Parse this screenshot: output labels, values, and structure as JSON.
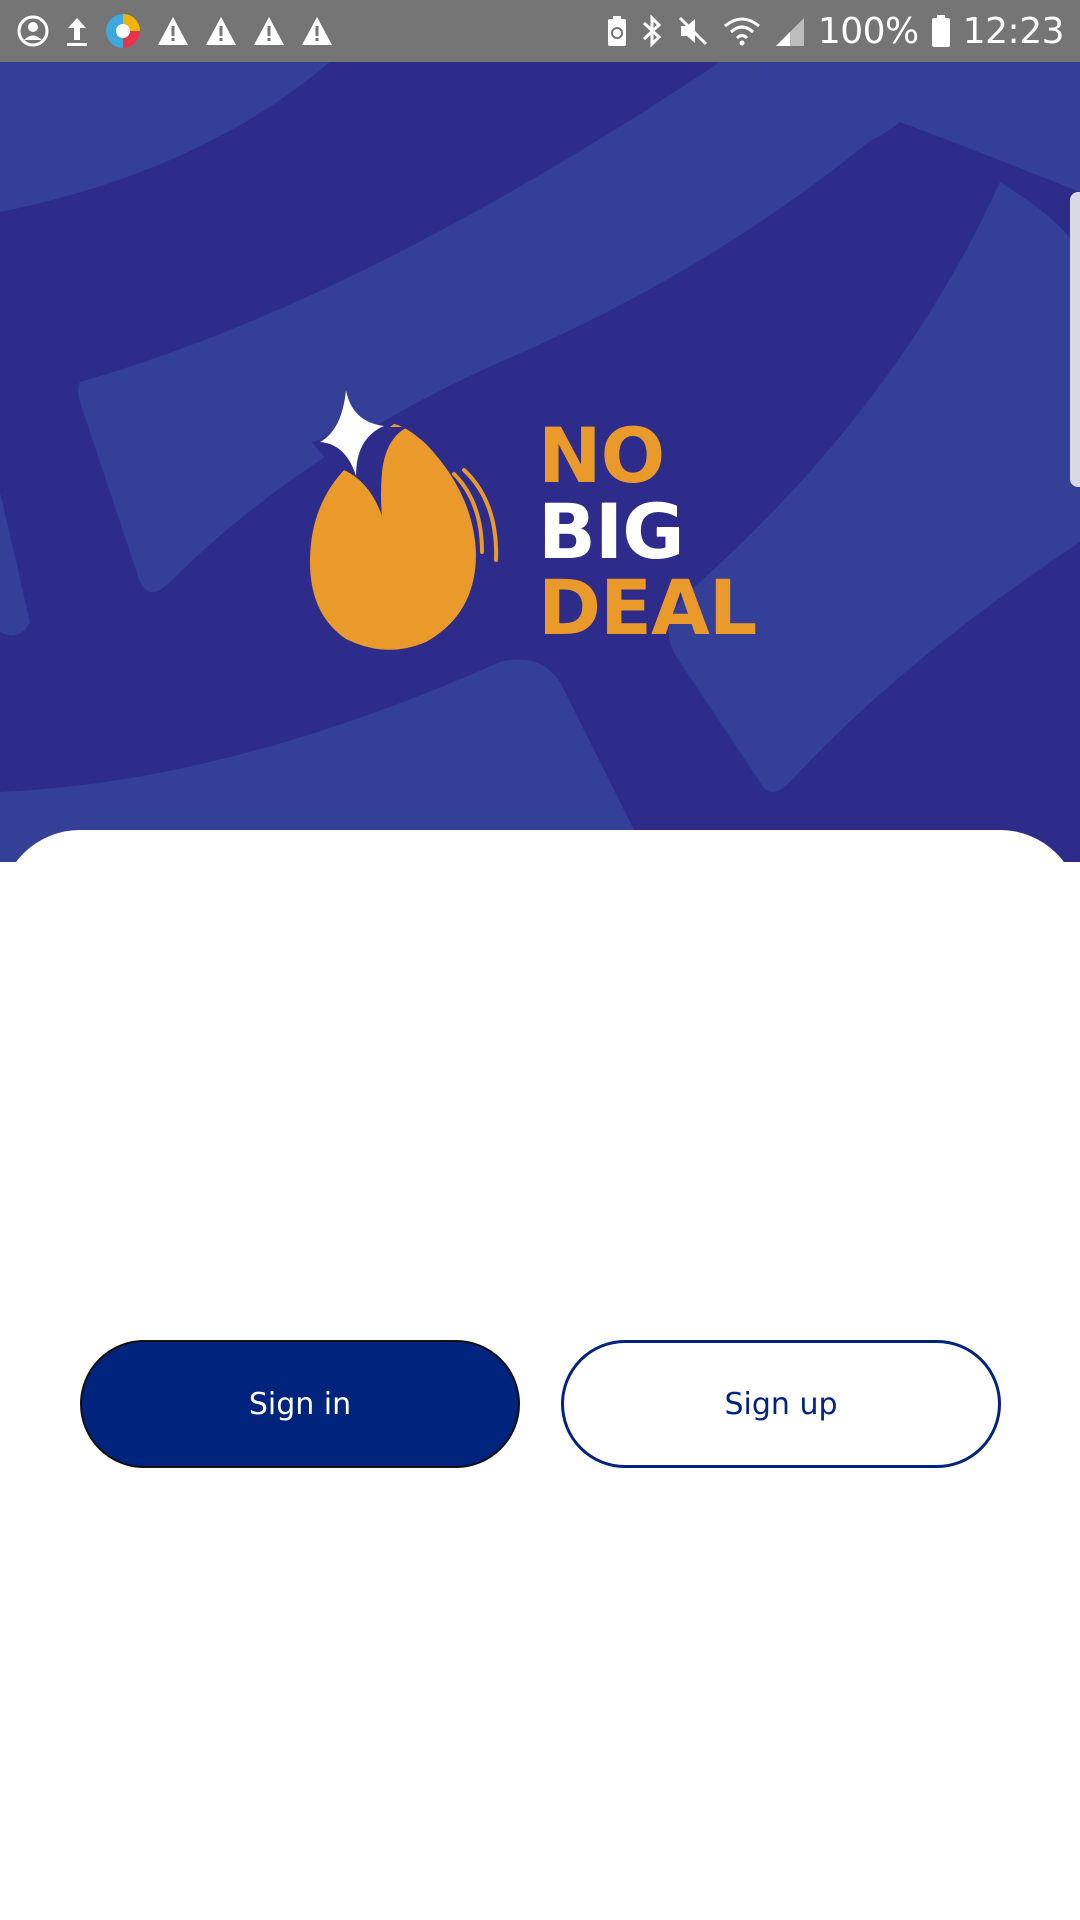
{
  "status_bar": {
    "battery": "100%",
    "time": "12:23",
    "left_icons": [
      "account-circle-icon",
      "upload-icon",
      "browser-app-icon",
      "warning-icon",
      "warning-icon",
      "warning-icon",
      "warning-icon"
    ],
    "right_icons": [
      "battery-saver-icon",
      "bluetooth-icon",
      "mute-icon",
      "wifi-icon",
      "signal-icon",
      "battery-icon"
    ]
  },
  "logo": {
    "line1": "NO",
    "line2": "BIG",
    "line3": "DEAL"
  },
  "actions": {
    "sign_in_label": "Sign in",
    "sign_up_label": "Sign up"
  },
  "colors": {
    "hero_background": "#2d2c8a",
    "hero_pattern": "#343f98",
    "brand_orange": "#ea9a2b",
    "primary_button": "#00247d",
    "status_bar": "#757575"
  }
}
